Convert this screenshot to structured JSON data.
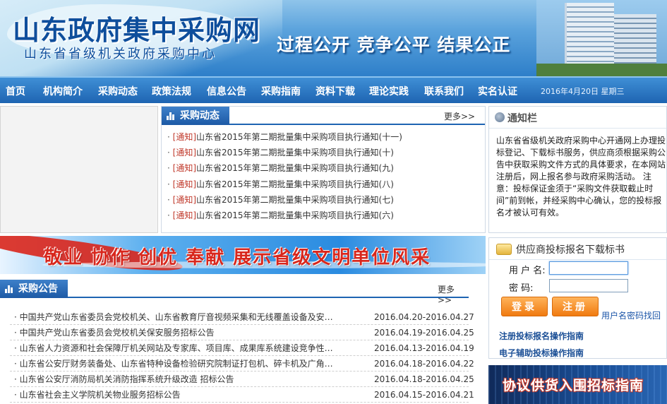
{
  "header": {
    "site_title": "山东政府集中采购网",
    "site_subtitle": "山东省省级机关政府采购中心",
    "slogan": "过程公开 竞争公平 结果公正"
  },
  "nav": {
    "items": [
      "首页",
      "机构简介",
      "采购动态",
      "政策法规",
      "信息公告",
      "采购指南",
      "资料下载",
      "理论实践",
      "联系我们",
      "实名认证"
    ],
    "date": "2016年4月20日 星期三"
  },
  "dynamics": {
    "title": "采购动态",
    "more": "更多>>",
    "items": [
      {
        "tag": "[通知]",
        "text": "山东省2015年第二期批量集中采购项目执行通知(十一)"
      },
      {
        "tag": "[通知]",
        "text": "山东省2015年第二期批量集中采购项目执行通知(十)"
      },
      {
        "tag": "[通知]",
        "text": "山东省2015年第二期批量集中采购项目执行通知(九)"
      },
      {
        "tag": "[通知]",
        "text": "山东省2015年第二期批量集中采购项目执行通知(八)"
      },
      {
        "tag": "[通知]",
        "text": "山东省2015年第二期批量集中采购项目执行通知(七)"
      },
      {
        "tag": "[通知]",
        "text": "山东省2015年第二期批量集中采购项目执行通知(六)"
      }
    ]
  },
  "notice": {
    "title": "通知栏",
    "text": "山东省省级机关政府采购中心开通网上办理投标登记、下载标书服务，供应商须根据采购公告中获取采购文件方式的具体要求，在本网站注册后，网上报名参与政府采购活动。 注意：投标保证金须于“采购文件获取截止时间”前到帐，并经采购中心确认，您的投标报名才被认可有效。"
  },
  "banner": {
    "text": "敬业 协作 创优 奉献  展示省级文明单位风采"
  },
  "announcements": {
    "title": "采购公告",
    "more": "更多>>",
    "rows": [
      {
        "title": "· 中国共产党山东省委员会党校机关、山东省教育厅音视频采集和无线覆盖设备及安…",
        "date": "2016.04.20-2016.04.27"
      },
      {
        "title": "· 中国共产党山东省委员会党校机关保安服务招标公告",
        "date": "2016.04.19-2016.04.25"
      },
      {
        "title": "· 山东省人力资源和社会保障厅机关网站及专家库、项目库、成果库系统建设竞争性…",
        "date": "2016.04.13-2016.04.19"
      },
      {
        "title": "· 山东省公安厅财务装备处、山东省特种设备检验研究院制证打包机、碎卡机及广角…",
        "date": "2016.04.18-2016.04.22"
      },
      {
        "title": "· 山东省公安厅消防局机关消防指挥系统升级改造 招标公告",
        "date": "2016.04.18-2016.04.25"
      },
      {
        "title": "· 山东省社会主义学院机关物业服务招标公告",
        "date": "2016.04.15-2016.04.21"
      }
    ]
  },
  "login": {
    "title": "供应商投标报名下载标书",
    "username_label": "用 户 名:",
    "password_label": "密    码:",
    "login_button": "登录",
    "register_button": "注册",
    "recover_link": "用户名密码找回",
    "guide1": "注册投标报名操作指南",
    "guide2": "电子辅助投标操作指南"
  },
  "xy_banner": {
    "text": "协议供货入围招标指南"
  },
  "colors": {
    "nav_blue": "#1e64b2",
    "accent_red": "#d8271d",
    "button_orange": "#f07a10"
  }
}
